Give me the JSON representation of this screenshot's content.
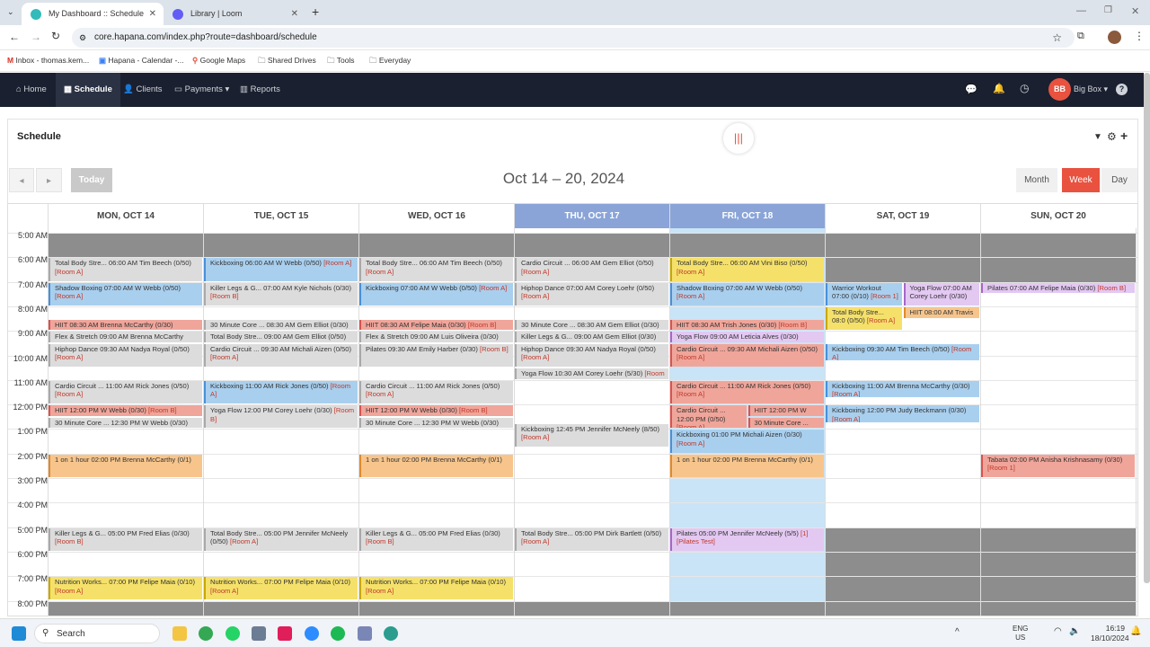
{
  "browser": {
    "tabs": [
      {
        "title": "My Dashboard :: Schedule",
        "active": true
      },
      {
        "title": "Library | Loom",
        "active": false
      }
    ],
    "url": "core.hapana.com/index.php?route=dashboard/schedule",
    "bookmarks": [
      "Inbox - thomas.kem...",
      "Hapana - Calendar -...",
      "Google Maps",
      "Shared Drives",
      "Tools",
      "Everyday"
    ]
  },
  "nav": {
    "items": [
      "Home",
      "Schedule",
      "Clients",
      "Payments",
      "Reports"
    ],
    "active": "Schedule",
    "avatar_initials": "BB",
    "brand": "Big Box"
  },
  "schedule": {
    "heading": "Schedule",
    "today": "Today",
    "range_title": "Oct 14 – 20, 2024",
    "views": [
      "Month",
      "Week",
      "Day"
    ],
    "active_view": "Week"
  },
  "days": [
    "MON, OCT 14",
    "TUE, OCT 15",
    "WED, OCT 16",
    "THU, OCT 17",
    "FRI, OCT 18",
    "SAT, OCT 19",
    "SUN, OCT 20"
  ],
  "highlight_days": [
    3,
    4
  ],
  "times": [
    "5:00 AM",
    "6:00 AM",
    "7:00 AM",
    "8:00 AM",
    "9:00 AM",
    "10:00 AM",
    "11:00 AM",
    "12:00 PM",
    "1:00 PM",
    "2:00 PM",
    "3:00 PM",
    "4:00 PM",
    "5:00 PM",
    "6:00 PM",
    "7:00 PM",
    "8:00 PM"
  ],
  "events": [
    {
      "day": 0,
      "start": 6,
      "end": 7,
      "color": "gray",
      "text": "Total Body Stre... 06:00 AM Tim Beech (0/50)",
      "room": "[Room A]"
    },
    {
      "day": 0,
      "start": 7,
      "end": 8,
      "color": "blue",
      "text": "Shadow Boxing 07:00 AM W Webb (0/50)",
      "room": "[Room A]"
    },
    {
      "day": 0,
      "start": 8.5,
      "end": 9,
      "color": "red",
      "text": "HIIT 08:30 AM Brenna McCarthy (0/30)",
      "room": ""
    },
    {
      "day": 0,
      "start": 9,
      "end": 9.5,
      "color": "gray",
      "text": "Flex & Stretch 09:00 AM Brenna McCarthy",
      "room": ""
    },
    {
      "day": 0,
      "start": 9.5,
      "end": 10.5,
      "color": "gray",
      "text": "Hiphop Dance 09:30 AM Nadya Royal (0/50)",
      "room": "[Room A]"
    },
    {
      "day": 0,
      "start": 11,
      "end": 12,
      "color": "gray",
      "text": "Cardio Circuit ... 11:00 AM Rick Jones (0/50)",
      "room": "[Room A]"
    },
    {
      "day": 0,
      "start": 12,
      "end": 12.5,
      "color": "red",
      "text": "HIIT 12:00 PM W Webb (0/30)",
      "room": "[Room B]"
    },
    {
      "day": 0,
      "start": 12.5,
      "end": 13,
      "color": "gray",
      "text": "30 Minute Core ... 12:30 PM W Webb (0/30)",
      "room": ""
    },
    {
      "day": 0,
      "start": 14,
      "end": 15,
      "color": "orange",
      "text": "1 on 1 hour 02:00 PM Brenna McCarthy (0/1)",
      "room": ""
    },
    {
      "day": 0,
      "start": 17,
      "end": 18,
      "color": "gray",
      "text": "Killer Legs & G... 05:00 PM Fred Elias (0/30)",
      "room": "[Room B]"
    },
    {
      "day": 0,
      "start": 19,
      "end": 20,
      "color": "yellow",
      "text": "Nutrition Works... 07:00 PM Felipe Maia (0/10)",
      "room": "[Room A]"
    },
    {
      "day": 1,
      "start": 6,
      "end": 7,
      "color": "blue",
      "text": "Kickboxing 06:00 AM W Webb (0/50)",
      "room": "[Room A]"
    },
    {
      "day": 1,
      "start": 7,
      "end": 8,
      "color": "gray",
      "text": "Killer Legs & G... 07:00 AM Kyle Nichols (0/30)",
      "room": "[Room B]"
    },
    {
      "day": 1,
      "start": 8.5,
      "end": 9,
      "color": "gray",
      "text": "30 Minute Core ... 08:30 AM Gem Elliot (0/30)",
      "room": ""
    },
    {
      "day": 1,
      "start": 9,
      "end": 9.5,
      "color": "gray",
      "text": "Total Body Stre... 09:00 AM Gem Elliot (0/50)",
      "room": ""
    },
    {
      "day": 1,
      "start": 9.5,
      "end": 10.5,
      "color": "gray",
      "text": "Cardio Circuit ... 09:30 AM Michali Aizen (0/50)",
      "room": "[Room A]"
    },
    {
      "day": 1,
      "start": 11,
      "end": 12,
      "color": "blue",
      "text": "Kickboxing 11:00 AM Rick Jones (0/50)",
      "room": "[Room A]"
    },
    {
      "day": 1,
      "start": 12,
      "end": 13,
      "color": "gray",
      "text": "Yoga Flow 12:00 PM Corey Loehr (0/30)",
      "room": "[Room B]"
    },
    {
      "day": 1,
      "start": 17,
      "end": 18,
      "color": "gray",
      "text": "Total Body Stre... 05:00 PM Jennifer McNeely (0/50)",
      "room": "[Room A]"
    },
    {
      "day": 1,
      "start": 19,
      "end": 20,
      "color": "yellow",
      "text": "Nutrition Works... 07:00 PM Felipe Maia (0/10)",
      "room": "[Room A]"
    },
    {
      "day": 2,
      "start": 6,
      "end": 7,
      "color": "gray",
      "text": "Total Body Stre... 06:00 AM Tim Beech (0/50)",
      "room": "[Room A]"
    },
    {
      "day": 2,
      "start": 7,
      "end": 8,
      "color": "blue",
      "text": "Kickboxing 07:00 AM W Webb (0/50)",
      "room": "[Room A]"
    },
    {
      "day": 2,
      "start": 8.5,
      "end": 9,
      "color": "red",
      "text": "HIIT 08:30 AM Felipe Maia (0/30)",
      "room": "[Room B]"
    },
    {
      "day": 2,
      "start": 9,
      "end": 9.5,
      "color": "gray",
      "text": "Flex & Stretch 09:00 AM Luis Oliveira (0/30)",
      "room": ""
    },
    {
      "day": 2,
      "start": 9.5,
      "end": 10.5,
      "color": "gray",
      "text": "Pilates 09:30 AM Emily Harber (0/30)",
      "room": "[Room B]"
    },
    {
      "day": 2,
      "start": 11,
      "end": 12,
      "color": "gray",
      "text": "Cardio Circuit ... 11:00 AM Rick Jones (0/50)",
      "room": "[Room A]"
    },
    {
      "day": 2,
      "start": 12,
      "end": 12.5,
      "color": "red",
      "text": "HIIT 12:00 PM W Webb (0/30)",
      "room": "[Room B]"
    },
    {
      "day": 2,
      "start": 12.5,
      "end": 13,
      "color": "gray",
      "text": "30 Minute Core ... 12:30 PM W Webb (0/30)",
      "room": ""
    },
    {
      "day": 2,
      "start": 14,
      "end": 15,
      "color": "orange",
      "text": "1 on 1 hour 02:00 PM Brenna McCarthy (0/1)",
      "room": ""
    },
    {
      "day": 2,
      "start": 17,
      "end": 18,
      "color": "gray",
      "text": "Killer Legs & G... 05:00 PM Fred Elias (0/30)",
      "room": "[Room B]"
    },
    {
      "day": 2,
      "start": 19,
      "end": 20,
      "color": "yellow",
      "text": "Nutrition Works... 07:00 PM Felipe Maia (0/10)",
      "room": "[Room A]"
    },
    {
      "day": 3,
      "start": 6,
      "end": 7,
      "color": "gray",
      "text": "Cardio Circuit ... 06:00 AM Gem Elliot (0/50)",
      "room": "[Room A]"
    },
    {
      "day": 3,
      "start": 7,
      "end": 8,
      "color": "gray",
      "text": "Hiphop Dance 07:00 AM Corey Loehr (0/50)",
      "room": "[Room A]"
    },
    {
      "day": 3,
      "start": 8.5,
      "end": 9,
      "color": "gray",
      "text": "30 Minute Core ... 08:30 AM Gem Elliot (0/30)",
      "room": ""
    },
    {
      "day": 3,
      "start": 9,
      "end": 9.5,
      "color": "gray",
      "text": "Killer Legs & G... 09:00 AM Gem Elliot (0/30)",
      "room": ""
    },
    {
      "day": 3,
      "start": 9.5,
      "end": 10.5,
      "color": "gray",
      "text": "Hiphop Dance 09:30 AM Nadya Royal (0/50)",
      "room": "[Room A]"
    },
    {
      "day": 3,
      "start": 10.5,
      "end": 11,
      "color": "gray",
      "text": "Yoga Flow 10:30 AM Corey Loehr (5/30)",
      "room": "[Room B]"
    },
    {
      "day": 3,
      "start": 12.75,
      "end": 13.75,
      "color": "gray",
      "text": "Kickboxing 12:45 PM Jennifer McNeely (8/50)",
      "room": "[Room A]"
    },
    {
      "day": 3,
      "start": 17,
      "end": 18,
      "color": "gray",
      "text": "Total Body Stre... 05:00 PM Dirk Bartlett (0/50)",
      "room": "[Room A]"
    },
    {
      "day": 4,
      "start": 6,
      "end": 7,
      "color": "yellow",
      "text": "Total Body Stre... 06:00 AM Vini Biso (0/50)",
      "room": "[Room A]"
    },
    {
      "day": 4,
      "start": 7,
      "end": 8,
      "color": "blue",
      "text": "Shadow Boxing 07:00 AM W Webb (0/50)",
      "room": "[Room A]"
    },
    {
      "day": 4,
      "start": 8.5,
      "end": 9,
      "color": "red",
      "text": "HIIT 08:30 AM Trish Jones (0/30)",
      "room": "[Room B]"
    },
    {
      "day": 4,
      "start": 9,
      "end": 9.5,
      "color": "purple",
      "text": "Yoga Flow 09:00 AM Leticia Alves (0/30)",
      "room": ""
    },
    {
      "day": 4,
      "start": 9.5,
      "end": 10.5,
      "color": "red",
      "text": "Cardio Circuit ... 09:30 AM Michali Aizen (0/50)",
      "room": "[Room A]"
    },
    {
      "day": 4,
      "start": 11,
      "end": 12,
      "color": "red",
      "text": "Cardio Circuit ... 11:00 AM Rick Jones (0/50)",
      "room": "[Room A]"
    },
    {
      "day": 4,
      "start": 12,
      "end": 13,
      "color": "red",
      "text": "Cardio Circuit ... 12:00 PM (0/50)",
      "room": "[Room A]",
      "col": 0,
      "cols": 2
    },
    {
      "day": 4,
      "start": 12,
      "end": 12.5,
      "color": "red",
      "text": "HIIT 12:00 PM W",
      "room": "",
      "col": 1,
      "cols": 2
    },
    {
      "day": 4,
      "start": 12.5,
      "end": 13,
      "color": "red",
      "text": "30 Minute Core ...",
      "room": "",
      "col": 1,
      "cols": 2
    },
    {
      "day": 4,
      "start": 13,
      "end": 14,
      "color": "blue",
      "text": "Kickboxing 01:00 PM Michali Aizen (0/30)",
      "room": "[Room A]"
    },
    {
      "day": 4,
      "start": 14,
      "end": 15,
      "color": "orange",
      "text": "1 on 1 hour 02:00 PM Brenna McCarthy (0/1)",
      "room": ""
    },
    {
      "day": 4,
      "start": 17,
      "end": 18,
      "color": "purple",
      "text": "Pilates 05:00 PM Jennifer McNeely (5/5)",
      "room": "[1] [Pilates Test]"
    },
    {
      "day": 5,
      "start": 7,
      "end": 8,
      "color": "blue",
      "text": "Warrior Workout 07:00 (0/10)",
      "room": "[Room 1]",
      "col": 0,
      "cols": 2
    },
    {
      "day": 5,
      "start": 7,
      "end": 8,
      "color": "purple",
      "text": "Yoga Flow 07:00 AM Corey Loehr (0/30)",
      "room": "",
      "col": 1,
      "cols": 2
    },
    {
      "day": 5,
      "start": 8,
      "end": 9,
      "color": "yellow",
      "text": "Total Body Stre... 08:0 (0/50)",
      "room": "[Room A]",
      "col": 0,
      "cols": 2
    },
    {
      "day": 5,
      "start": 8,
      "end": 8.5,
      "color": "orange",
      "text": "HIIT 08:00 AM Travis",
      "room": "",
      "col": 1,
      "cols": 2
    },
    {
      "day": 5,
      "start": 9.5,
      "end": 10.25,
      "color": "blue",
      "text": "Kickboxing 09:30 AM Tim Beech (0/50)",
      "room": "[Room A]"
    },
    {
      "day": 5,
      "start": 11,
      "end": 11.75,
      "color": "blue",
      "text": "Kickboxing 11:00 AM Brenna McCarthy (0/30)",
      "room": "[Room A]"
    },
    {
      "day": 5,
      "start": 12,
      "end": 12.75,
      "color": "blue",
      "text": "Kickboxing 12:00 PM Judy Beckmann (0/30)",
      "room": "[Room A]"
    },
    {
      "day": 6,
      "start": 7,
      "end": 7.5,
      "color": "purple",
      "text": "Pilates 07:00 AM Felipe Maia (0/30)",
      "room": "[Room B]"
    },
    {
      "day": 6,
      "start": 14,
      "end": 15,
      "color": "red",
      "text": "Tabata 02:00 PM Anisha Krishnasamy (0/30)",
      "room": "[Room 1]"
    }
  ],
  "taskbar": {
    "search": "Search",
    "lang": "ENG",
    "region": "US",
    "time": "16:19",
    "date": "18/10/2024"
  },
  "colors": {
    "accent": "#e8523f",
    "nav_bg": "#1b2030",
    "highlight": "#8aa4d8"
  }
}
